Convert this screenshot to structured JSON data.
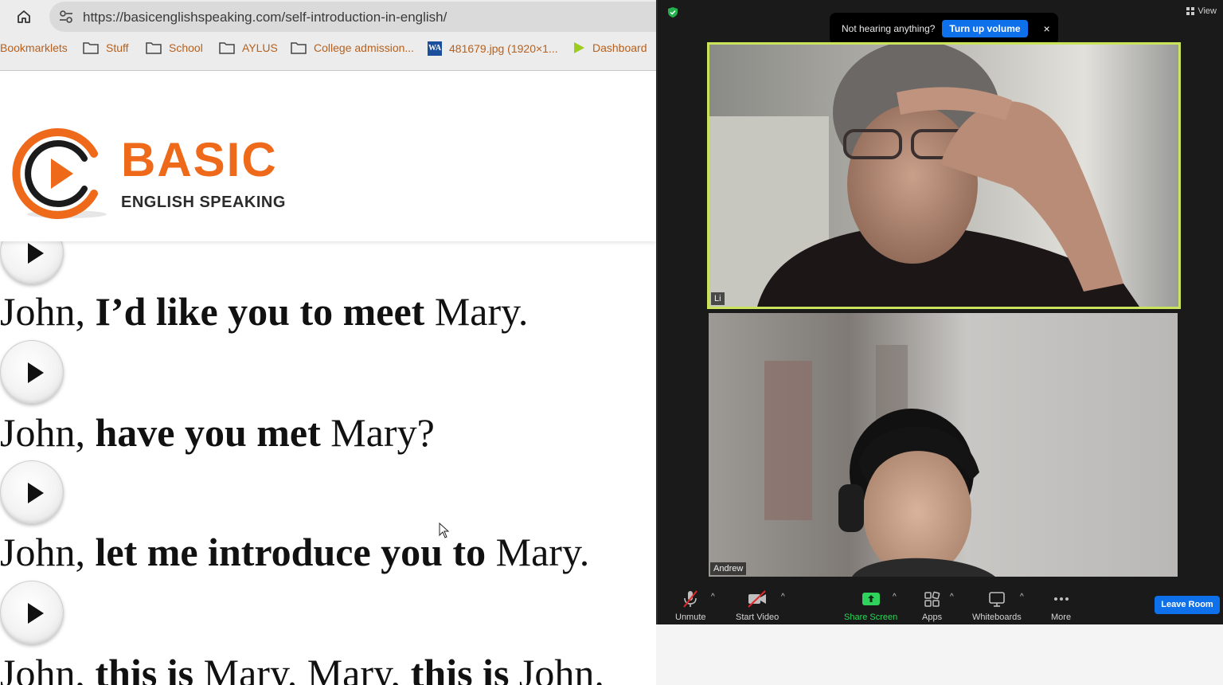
{
  "browser": {
    "url": "https://basicenglishspeaking.com/self-introduction-in-english/",
    "bookmarks": [
      "Bookmarklets",
      "Stuff",
      "School",
      "AYLUS",
      "College admission...",
      "481679.jpg (1920×1...",
      "Dashboard"
    ]
  },
  "page": {
    "logo": {
      "word": "BASIC",
      "subtitle": "ENGLISH SPEAKING"
    },
    "phrases": [
      {
        "prefix": "John, ",
        "bold": "I’d like you to meet",
        "suffix": " Mary."
      },
      {
        "prefix": "John, ",
        "bold": "have you met",
        "suffix": " Mary?"
      },
      {
        "prefix": "John, ",
        "bold": "let me introduce you to",
        "suffix": " Mary."
      },
      {
        "prefix": "John, ",
        "bold": "this is",
        "suffix": " Mary. Mary, ",
        "bold2": "this is",
        "suffix2": " John."
      }
    ]
  },
  "zoom": {
    "view_label": "View",
    "notice": {
      "text": "Not hearing anything?",
      "button": "Turn up volume",
      "close": "×"
    },
    "participants": [
      {
        "name": "Li"
      },
      {
        "name": "Andrew"
      }
    ],
    "toolbar": {
      "unmute": "Unmute",
      "start_video": "Start Video",
      "share_screen": "Share Screen",
      "apps": "Apps",
      "whiteboards": "Whiteboards",
      "more": "More",
      "leave": "Leave Room"
    },
    "colors": {
      "accent_blue": "#0e71eb",
      "share_green": "#2fd35b",
      "active_speaker": "#c9e35c",
      "logo_orange": "#ee6a1a"
    }
  }
}
